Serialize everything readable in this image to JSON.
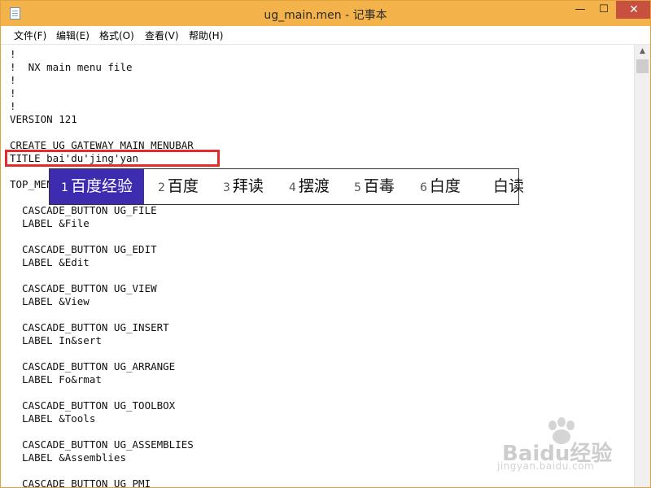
{
  "window": {
    "title": "ug_main.men - 记事本",
    "min_glyph": "—",
    "max_glyph": "☐",
    "close_glyph": "✕",
    "titlebar_color": "#f3b24a",
    "close_color": "#c7503e"
  },
  "menubar": {
    "items": [
      {
        "label": "文件(F)"
      },
      {
        "label": "编辑(E)"
      },
      {
        "label": "格式(O)"
      },
      {
        "label": "查看(V)"
      },
      {
        "label": "帮助(H)"
      }
    ]
  },
  "editor": {
    "lines": [
      "!",
      "!  NX main menu file",
      "!",
      "!",
      "!",
      "VERSION 121",
      "",
      "CREATE_UG_GATEWAY_MAIN_MENUBAR",
      "TITLE bai'du'jing'yan",
      "",
      "TOP_MENU",
      "",
      "  CASCADE_BUTTON UG_FILE",
      "  LABEL &File",
      "",
      "  CASCADE_BUTTON UG_EDIT",
      "  LABEL &Edit",
      "",
      "  CASCADE_BUTTON UG_VIEW",
      "  LABEL &View",
      "",
      "  CASCADE_BUTTON UG_INSERT",
      "  LABEL In&sert",
      "",
      "  CASCADE_BUTTON UG_ARRANGE",
      "  LABEL Fo&rmat",
      "",
      "  CASCADE_BUTTON UG_TOOLBOX",
      "  LABEL &Tools",
      "",
      "  CASCADE_BUTTON UG_ASSEMBLIES",
      "  LABEL &Assemblies",
      "",
      "  CASCADE_BUTTON UG_PMI"
    ],
    "highlight_color": "#e42a2a"
  },
  "ime": {
    "selected_color": "#3d2cb0",
    "candidates": [
      {
        "num": "1",
        "text": "百度经验"
      },
      {
        "num": "2",
        "text": "百度"
      },
      {
        "num": "3",
        "text": "拜读"
      },
      {
        "num": "4",
        "text": "摆渡"
      },
      {
        "num": "5",
        "text": "百毒"
      },
      {
        "num": "6",
        "text": "白度"
      },
      {
        "num": "",
        "text": "白读"
      }
    ]
  },
  "scrollbar": {
    "up_arrow": "▲"
  },
  "watermark": {
    "brand": "Baidu经验",
    "sub": "jingyan.baidu.com"
  }
}
